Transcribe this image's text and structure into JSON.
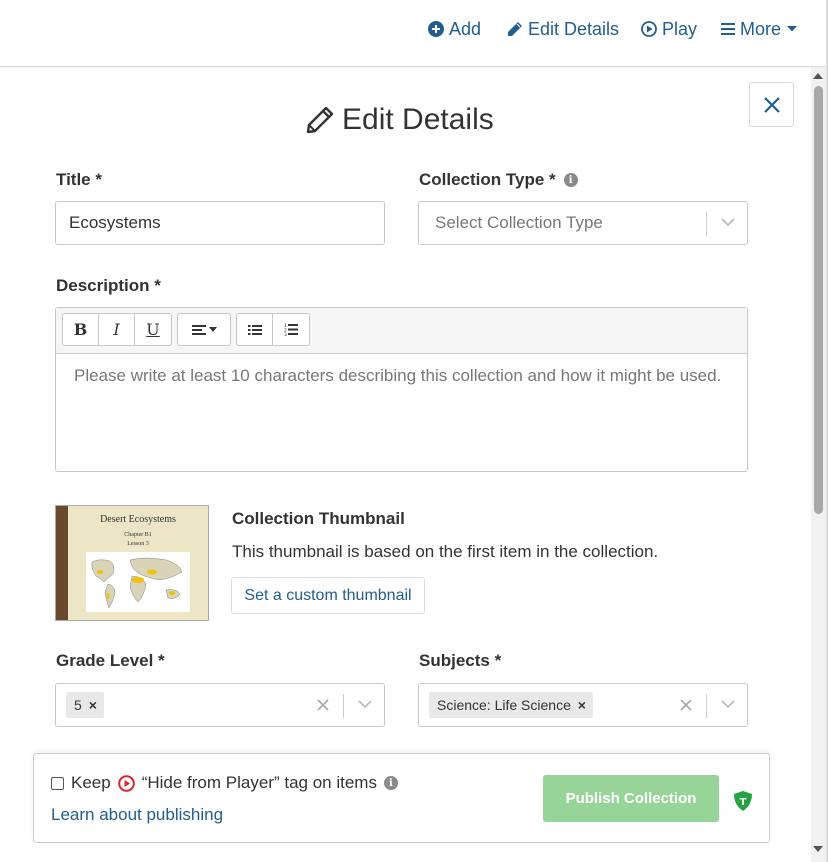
{
  "nav": {
    "add": "Add",
    "edit_details": "Edit Details",
    "play": "Play",
    "more": "More"
  },
  "modal": {
    "heading": "Edit Details",
    "title_label": "Title *",
    "title_value": "Ecosystems",
    "collection_type_label": "Collection Type *",
    "collection_type_placeholder": "Select Collection Type",
    "description_label": "Description *",
    "description_placeholder": "Please write at least 10 characters describing this collection and how it might be used.",
    "toolbar": {
      "bold": "B",
      "italic": "I",
      "underline": "U"
    },
    "thumbnail": {
      "image_title": "Desert Ecosystems",
      "image_line1": "Chapter B1",
      "image_line2": "Lesson 3",
      "title": "Collection Thumbnail",
      "description": "This thumbnail is based on the first item in the collection.",
      "button": "Set a custom thumbnail"
    },
    "grade_label": "Grade Level *",
    "grade_chip": "5",
    "subjects_label": "Subjects *",
    "subjects_chip": "Science: Life Science"
  },
  "footer": {
    "keep_prefix": "Keep",
    "keep_suffix": "“Hide from Player” tag on items",
    "learn_link": "Learn about publishing",
    "publish_button": "Publish Collection"
  },
  "colors": {
    "link": "#215e8f",
    "publish_disabled": "#97d497",
    "shield": "#27a243",
    "play_red": "#d9252a"
  }
}
